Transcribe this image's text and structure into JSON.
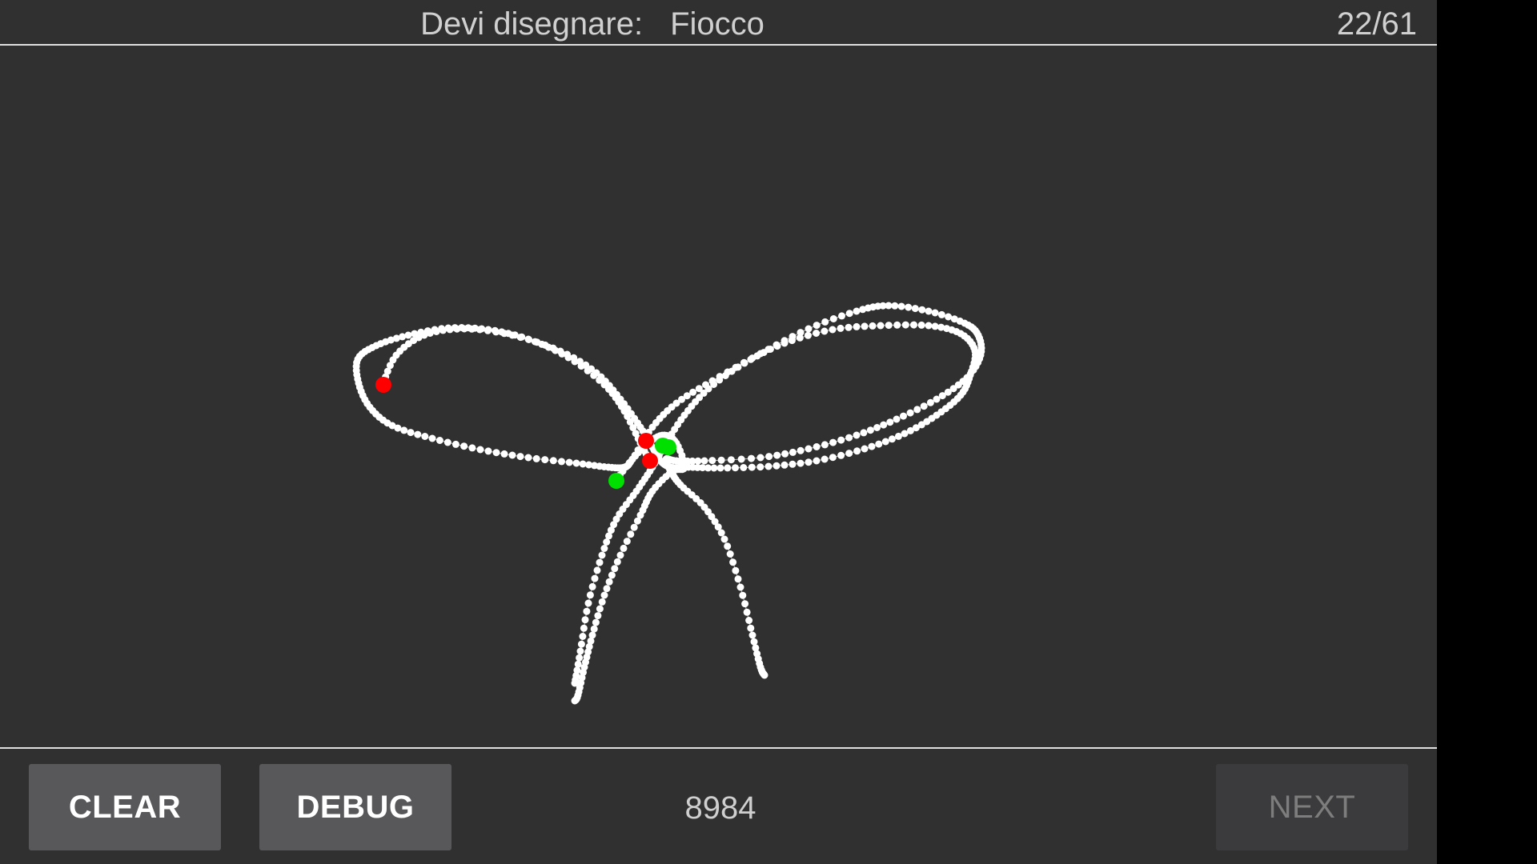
{
  "header": {
    "prompt_label": "Devi disegnare:",
    "prompt_word": "Fiocco",
    "progress": "22/61"
  },
  "footer": {
    "clear_label": "CLEAR",
    "debug_label": "DEBUG",
    "score": "8984",
    "next_label": "NEXT"
  },
  "colors": {
    "background": "#303030",
    "stroke_points": "#ffffff",
    "start_marker": "#00e000",
    "end_marker": "#ff0000",
    "divider": "#e0e0e0"
  },
  "drawing": {
    "description_icon": "bow-sketch",
    "stroke_count": 3
  }
}
